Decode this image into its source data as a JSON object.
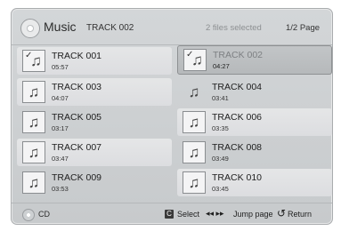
{
  "header": {
    "title": "Music",
    "current_track": "TRACK 002",
    "selection_info": "2 files selected",
    "page_info": "1/2 Page"
  },
  "tracks": [
    {
      "title": "TRACK 001",
      "duration": "05:57",
      "checked": true
    },
    {
      "title": "TRACK 002",
      "duration": "04:27",
      "checked": true
    },
    {
      "title": "TRACK 003",
      "duration": "04:07",
      "checked": false
    },
    {
      "title": "TRACK 004",
      "duration": "03:41",
      "checked": false
    },
    {
      "title": "TRACK 005",
      "duration": "03:17",
      "checked": false
    },
    {
      "title": "TRACK 006",
      "duration": "03:35",
      "checked": false
    },
    {
      "title": "TRACK 007",
      "duration": "03:47",
      "checked": false
    },
    {
      "title": "TRACK 008",
      "duration": "03:49",
      "checked": false
    },
    {
      "title": "TRACK 009",
      "duration": "03:53",
      "checked": false
    },
    {
      "title": "TRACK 010",
      "duration": "03:45",
      "checked": false
    }
  ],
  "footer": {
    "source": "CD",
    "select_key": "C",
    "select_label": "Select",
    "jump_arrows": "◂◂ ▸▸",
    "jump_label": "Jump page",
    "return_label": "Return"
  },
  "icons": {
    "music_note": "♫",
    "check": "✓",
    "return": "↺"
  }
}
